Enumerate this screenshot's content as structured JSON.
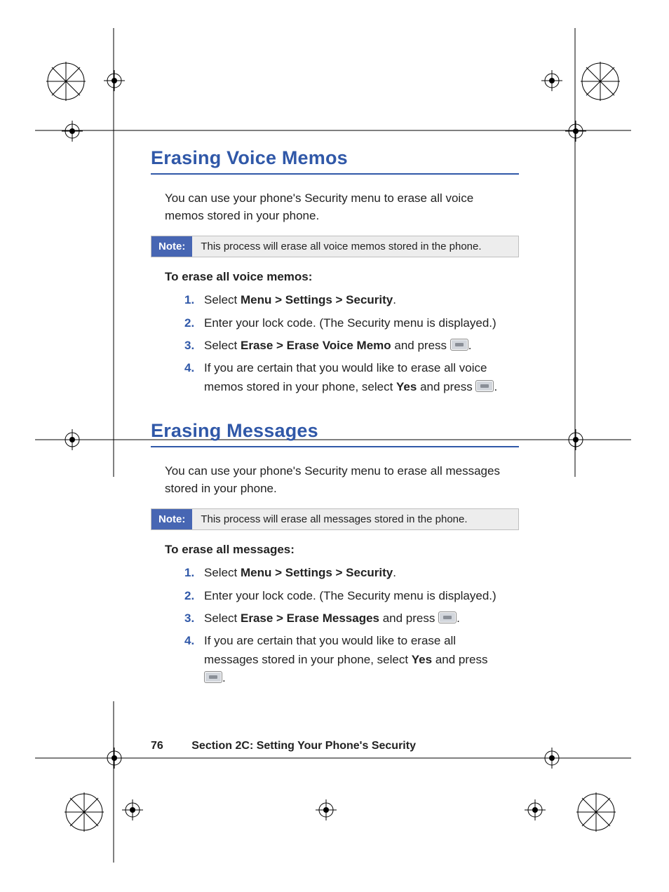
{
  "section1": {
    "title": "Erasing Voice Memos",
    "intro": "You can use your phone's Security menu to erase all voice memos stored in your phone.",
    "noteLabel": "Note:",
    "noteText": "This process will erase all voice memos stored in the phone.",
    "subheading": "To erase all voice memos:",
    "steps": {
      "s1a": "Select ",
      "s1b": "Menu > Settings > Security",
      "s1c": ".",
      "s2": "Enter your lock code. (The Security menu is displayed.)",
      "s3a": "Select ",
      "s3b": "Erase > Erase Voice Memo",
      "s3c": " and press ",
      "s3d": ".",
      "s4a": "If you are certain that you would like to erase all voice memos stored in your phone, select ",
      "s4b": "Yes",
      "s4c": " and press ",
      "s4d": "."
    }
  },
  "section2": {
    "title": "Erasing Messages",
    "intro": "You can use your phone's Security menu to erase all messages stored in your phone.",
    "noteLabel": "Note:",
    "noteText": "This process will erase all messages stored in the phone.",
    "subheading": "To erase all messages:",
    "steps": {
      "s1a": "Select ",
      "s1b": "Menu > Settings > Security",
      "s1c": ".",
      "s2": "Enter your lock code. (The Security menu is displayed.)",
      "s3a": "Select ",
      "s3b": "Erase > Erase Messages",
      "s3c": " and press ",
      "s3d": ".",
      "s4a": "If you are certain that you would like to erase all messages stored in your phone, select ",
      "s4b": "Yes",
      "s4c": " and press ",
      "s4d": "."
    }
  },
  "footer": {
    "page": "76",
    "section": "Section 2C: Setting Your Phone's Security"
  }
}
